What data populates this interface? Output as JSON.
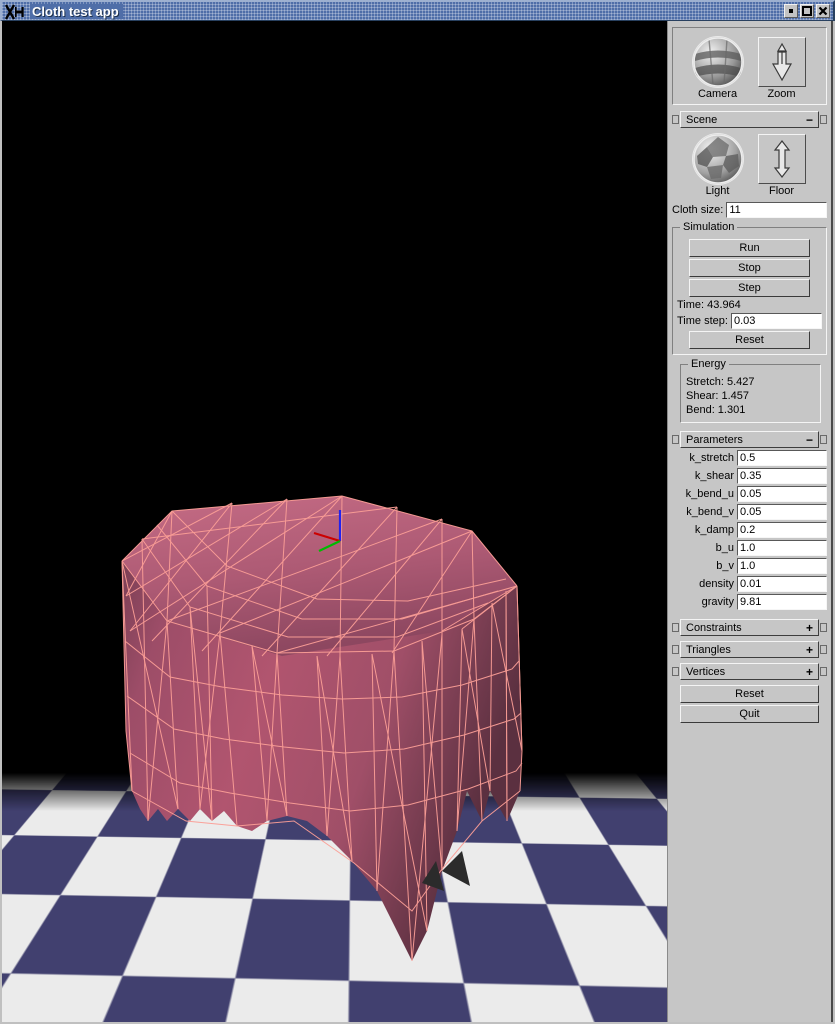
{
  "window": {
    "title": "Cloth test app",
    "icon": "x11-logo-icon",
    "buttons": {
      "minimize": "▪",
      "maximize": "❐",
      "close": "✕"
    }
  },
  "viewport": {
    "name": "3d-cloth-viewport",
    "background_color": "#000000",
    "floor": {
      "dark_color": "#41406f",
      "light_color": "#ebebeb",
      "pattern": "checkerboard"
    },
    "cloth": {
      "fill_color": "#a8526e",
      "wire_color": "#fb9e96",
      "shape": "cloth draped over a cube"
    },
    "axes": {
      "x_color": "#cc0000",
      "y_color": "#00bb00",
      "z_color": "#2222ee"
    }
  },
  "panel": {
    "trackballs": [
      {
        "label": "Camera",
        "icon": "trackball-sphere-icon"
      },
      {
        "label": "Zoom",
        "icon": "zoom-arrow-icon"
      }
    ],
    "scene": {
      "title": "Scene",
      "toggle_sign": "−",
      "trackballs": [
        {
          "label": "Light",
          "icon": "light-sphere-icon"
        },
        {
          "label": "Floor",
          "icon": "floor-arrow-icon"
        }
      ],
      "cloth_size": {
        "label": "Cloth size:",
        "value": "11"
      }
    },
    "simulation": {
      "title": "Simulation",
      "run_label": "Run",
      "stop_label": "Stop",
      "step_label": "Step",
      "time_text": "Time: 43.964",
      "time_step": {
        "label": "Time step:",
        "value": "0.03"
      },
      "reset_label": "Reset"
    },
    "energy": {
      "title": "Energy",
      "stretch": "Stretch: 5.427",
      "shear": "Shear: 1.457",
      "bend": "Bend: 1.301"
    },
    "parameters": {
      "title": "Parameters",
      "toggle_sign": "−",
      "rows": [
        {
          "label": "k_stretch",
          "value": "0.5"
        },
        {
          "label": "k_shear",
          "value": "0.35"
        },
        {
          "label": "k_bend_u",
          "value": "0.05"
        },
        {
          "label": "k_bend_v",
          "value": "0.05"
        },
        {
          "label": "k_damp",
          "value": "0.2"
        },
        {
          "label": "b_u",
          "value": "1.0"
        },
        {
          "label": "b_v",
          "value": "1.0"
        },
        {
          "label": "density",
          "value": "0.01"
        },
        {
          "label": "gravity",
          "value": "9.81"
        }
      ]
    },
    "collapsed": [
      {
        "title": "Constraints",
        "sign": "+"
      },
      {
        "title": "Triangles",
        "sign": "+"
      },
      {
        "title": "Vertices",
        "sign": "+"
      }
    ],
    "footer": {
      "reset_label": "Reset",
      "quit_label": "Quit"
    }
  }
}
